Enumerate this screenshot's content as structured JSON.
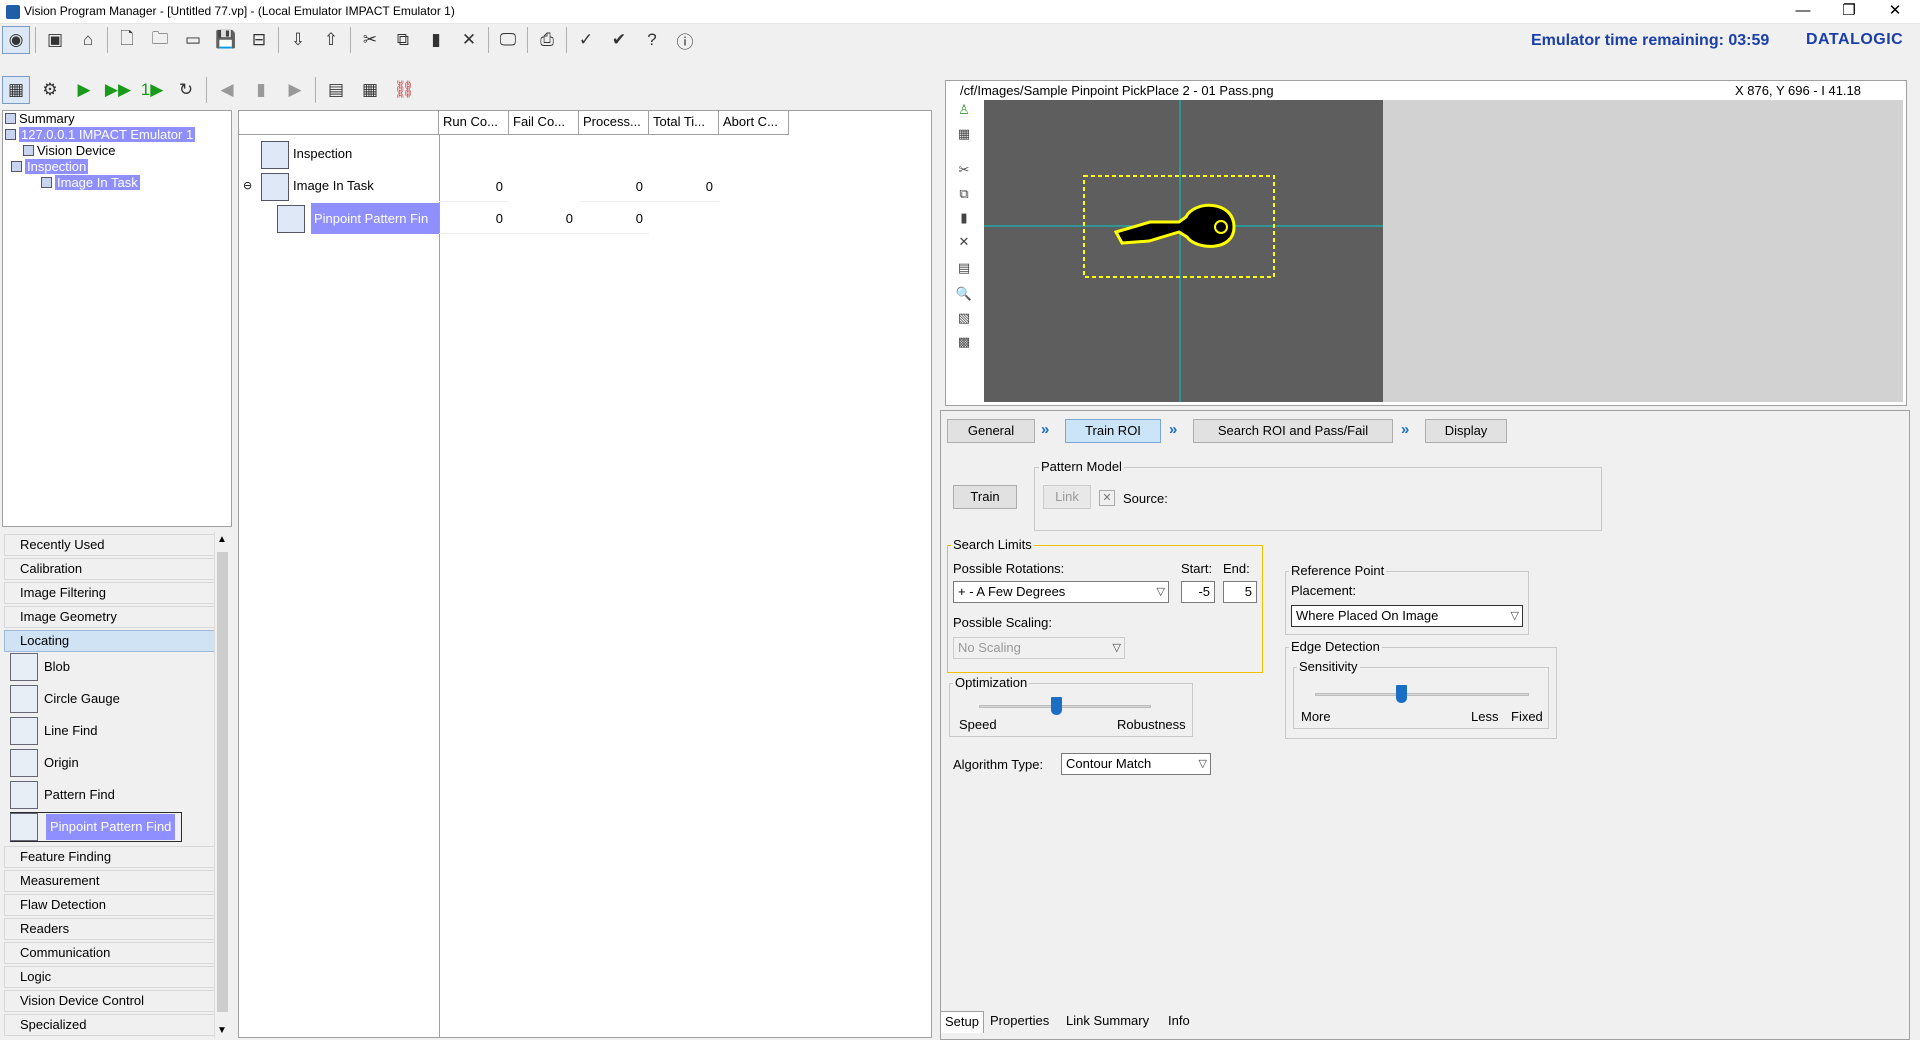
{
  "window": {
    "title": "Vision Program Manager - [Untitled 77.vp] - (Local Emulator IMPACT Emulator 1)",
    "minimize": "—",
    "restore": "❐",
    "close": "✕"
  },
  "toolbar": {
    "emulator_time": "Emulator time remaining: 03:59",
    "brand": "DATALOGIC"
  },
  "tree": {
    "summary": "Summary",
    "device": "127.0.0.1 IMPACT Emulator 1",
    "vision_device": "Vision Device",
    "inspection": "Inspection",
    "image_in_task": "Image In Task"
  },
  "toolbox": {
    "categories_top": [
      "Recently Used",
      "Calibration",
      "Image Filtering",
      "Image Geometry"
    ],
    "open_category": "Locating",
    "tools": [
      "Blob",
      "Circle Gauge",
      "Line Find",
      "Origin",
      "Pattern Find",
      "Pinpoint Pattern Find"
    ],
    "categories_bottom": [
      "Feature Finding",
      "Measurement",
      "Flaw Detection",
      "Readers",
      "Communication",
      "Logic",
      "Vision Device Control",
      "Specialized"
    ]
  },
  "grid": {
    "columns": [
      "Run Co...",
      "Fail Co...",
      "Process...",
      "Total Ti...",
      "Abort C..."
    ],
    "rows": [
      {
        "name": "Inspection",
        "values": [
          "",
          "",
          "",
          "",
          ""
        ]
      },
      {
        "name": "Image In Task",
        "values": [
          "0",
          "",
          "0",
          "0",
          ""
        ]
      },
      {
        "name": "Pinpoint Pattern Fin",
        "values": [
          "0",
          "0",
          "0",
          "",
          ""
        ]
      }
    ]
  },
  "viewer": {
    "path": "/cf/Images/Sample Pinpoint PickPlace 2 - 01 Pass.png",
    "coords": "X 876,  Y 696  -  I 41.18"
  },
  "setup": {
    "tabs": [
      "General",
      "Train ROI",
      "Search ROI and Pass/Fail",
      "Display"
    ],
    "active_tab": "Train ROI",
    "train_button": "Train",
    "pattern_model": {
      "legend": "Pattern Model",
      "link_button": "Link",
      "source_label": "Source:"
    },
    "search_limits": {
      "legend": "Search Limits",
      "rotations_label": "Possible Rotations:",
      "rotations_value": "+ - A Few Degrees",
      "start_label": "Start:",
      "start_value": "-5",
      "end_label": "End:",
      "end_value": "5",
      "scaling_label": "Possible Scaling:",
      "scaling_value": "No Scaling"
    },
    "optimization": {
      "legend": "Optimization",
      "left": "Speed",
      "right": "Robustness",
      "level": 0.45
    },
    "algorithm": {
      "label": "Algorithm Type:",
      "value": "Contour Match"
    },
    "reference_point": {
      "legend": "Reference Point",
      "placement_label": "Placement:",
      "placement_value": "Where Placed On Image"
    },
    "edge_detection": {
      "legend": "Edge Detection",
      "sensitivity_legend": "Sensitivity",
      "more": "More",
      "less": "Less",
      "fixed": "Fixed",
      "level": 0.4
    }
  },
  "bottom_tabs": [
    "Setup",
    "Properties",
    "Link Summary",
    "Info"
  ],
  "colors": {
    "accent": "#1a3fa8",
    "selection": "#8f8fff",
    "roi": "#ffff00",
    "crosshair": "#00cccc"
  }
}
